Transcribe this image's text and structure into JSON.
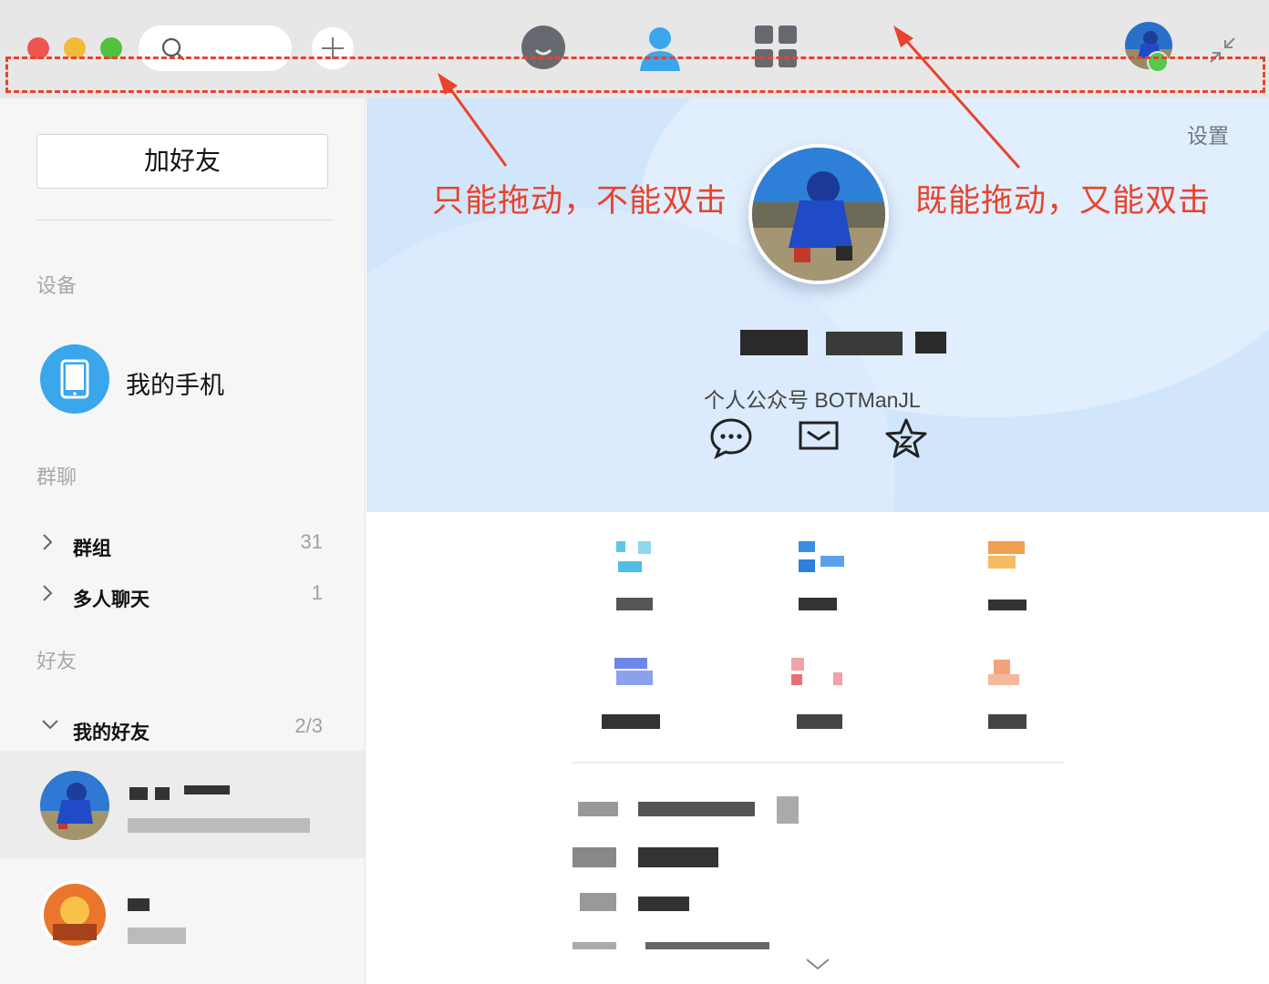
{
  "toolbar": {
    "search_icon": "search-icon",
    "add_icon": "plus-icon",
    "nav_tabs": [
      "chat-icon",
      "contacts-icon",
      "apps-icon"
    ],
    "shrink_icon": "shrink-icon"
  },
  "annotations": {
    "left": "只能拖动，不能双击",
    "right": "既能拖动，又能双击",
    "color": "#e8432c"
  },
  "sidebar": {
    "add_friend_label": "加好友",
    "devices_label": "设备",
    "device_name": "我的手机",
    "groups_label": "群聊",
    "groups": [
      {
        "name": "群组",
        "count": "31"
      },
      {
        "name": "多人聊天",
        "count": "1"
      }
    ],
    "friends_label": "好友",
    "friend_group": {
      "name": "我的好友",
      "count": "2/3"
    }
  },
  "profile": {
    "settings_label": "设置",
    "signature": "个人公众号 BOTManJL",
    "accent": "#d2e6fb"
  },
  "colors": {
    "titlebar": "#e7e7e8",
    "sidebar": "#f6f6f7",
    "device_icon": "#3aa6ec",
    "nav_contacts_active": "#3aa6ec"
  }
}
